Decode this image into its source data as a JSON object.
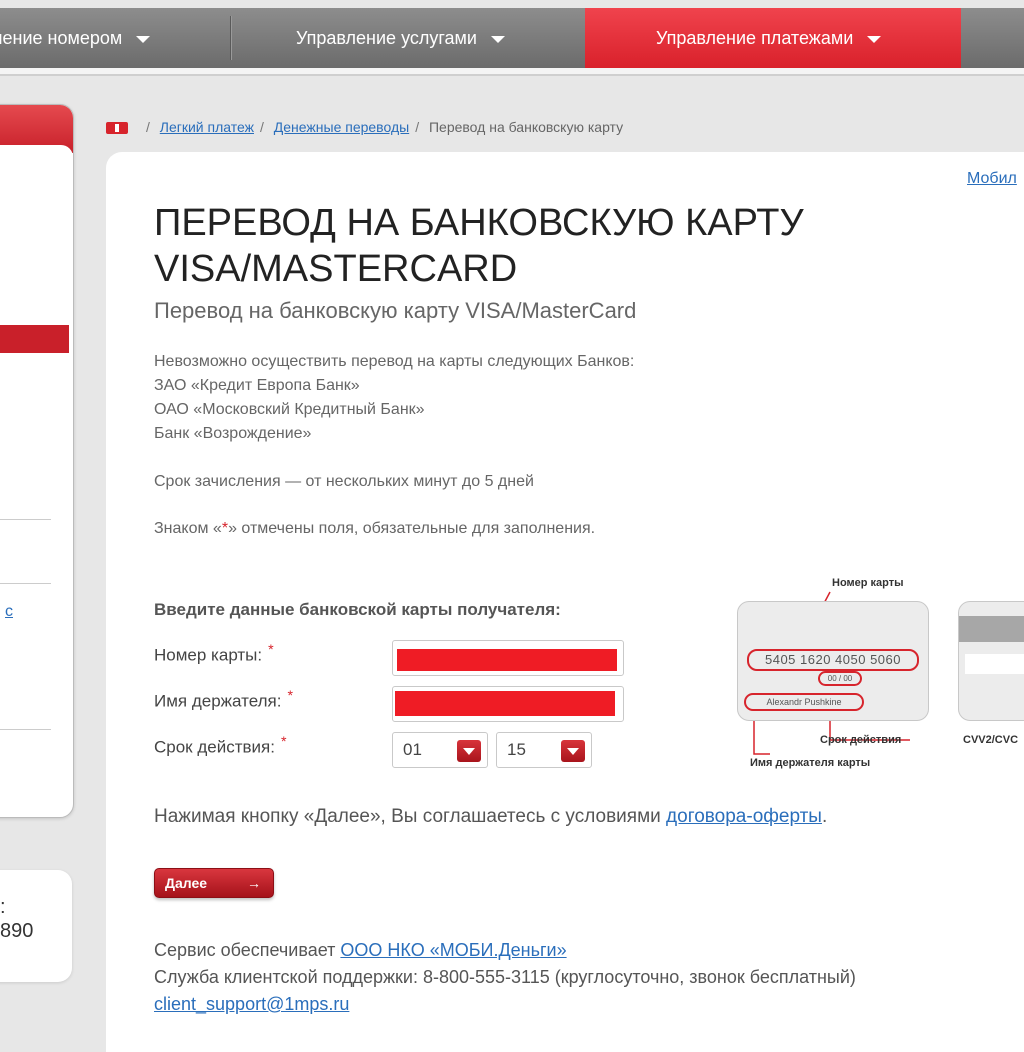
{
  "nav": {
    "items": [
      {
        "label": "ление номером",
        "active": false
      },
      {
        "label": "Управление услугами",
        "active": false
      },
      {
        "label": "Управление платежами",
        "active": true
      }
    ]
  },
  "left": {
    "link_text": "c",
    "box_line1": ":",
    "box_line2": "890"
  },
  "breadcrumb": {
    "items": [
      "Легкий платеж",
      "Денежные переводы"
    ],
    "current": "Перевод на банковскую карту"
  },
  "mobile_link": "Мобил",
  "page": {
    "title": "ПЕРЕВОД НА БАНКОВСКУЮ КАРТУ VISA/MASTERCARD",
    "subtitle": "Перевод на банковскую карту VISA/MasterCard",
    "restriction_intro": "Невозможно осуществить перевод на карты следующих Банков:",
    "banks": [
      "ЗАО «Кредит Европа Банк»",
      "ОАО «Московский Кредитный Банк»",
      "Банк «Возрождение»"
    ],
    "term": "Срок зачисления — от нескольких минут до 5 дней",
    "required_prefix": "Знаком «",
    "required_star": "*",
    "required_suffix": "» отмечены поля, обязательные для заполнения."
  },
  "form": {
    "heading": "Введите данные банковской карты получателя:",
    "card_number_label": "Номер карты:",
    "holder_label": "Имя держателя:",
    "expiry_label": "Срок действия:",
    "required_mark": "*",
    "expiry_month": "01",
    "expiry_year": "15"
  },
  "card_illustration": {
    "card_number_caption": "Номер карты",
    "card_number_sample": "5405 1620 4050 5060",
    "expiry_sample": "00 / 00",
    "holder_sample": "Alexandr Pushkine",
    "expiry_caption": "Срок действия",
    "holder_caption": "Имя держателя карты",
    "cvv_caption": "CVV2/CVC"
  },
  "agreement": {
    "text": "Нажимая кнопку «Далее», Вы соглашаетесь с условиями",
    "link": "договора-оферты",
    "end": "."
  },
  "next_button": {
    "label": "Далее",
    "arrow": "→"
  },
  "footer": {
    "service_text": "Сервис обеспечивает",
    "service_link": "ООО НКО «МОБИ.Деньги»",
    "support_text": "Служба клиентской поддержки: 8-800-555-3115 (круглосуточно, звонок бесплатный)",
    "email": "client_support@1mps.ru"
  },
  "colors": {
    "accent": "#d7242c",
    "link": "#2a6ebb",
    "nav": "#7a7a7a"
  }
}
